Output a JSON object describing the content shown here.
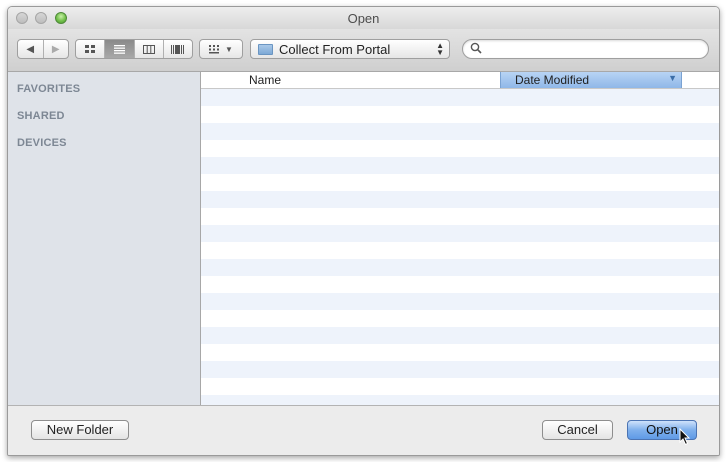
{
  "window": {
    "title": "Open"
  },
  "toolbar": {
    "nav_back_icon": "back-arrow-icon",
    "nav_forward_icon": "forward-arrow-icon",
    "views": [
      "icon-view-icon",
      "list-view-icon",
      "column-view-icon",
      "coverflow-view-icon"
    ],
    "active_view": 1,
    "arrange_icon": "arrange-icon",
    "location": "Collect From Portal",
    "search_value": "",
    "search_placeholder": ""
  },
  "sidebar": {
    "headers": [
      "FAVORITES",
      "SHARED",
      "DEVICES"
    ]
  },
  "file_list": {
    "columns": [
      "Name",
      "Date Modified"
    ],
    "sorted_column": "Date Modified",
    "rows": []
  },
  "buttons": {
    "new_folder": "New Folder",
    "cancel": "Cancel",
    "open": "Open"
  },
  "colors": {
    "accent": "#8fb7e8",
    "sidebar_bg": "#dfe3e9",
    "stripe": "#eef3fb"
  }
}
